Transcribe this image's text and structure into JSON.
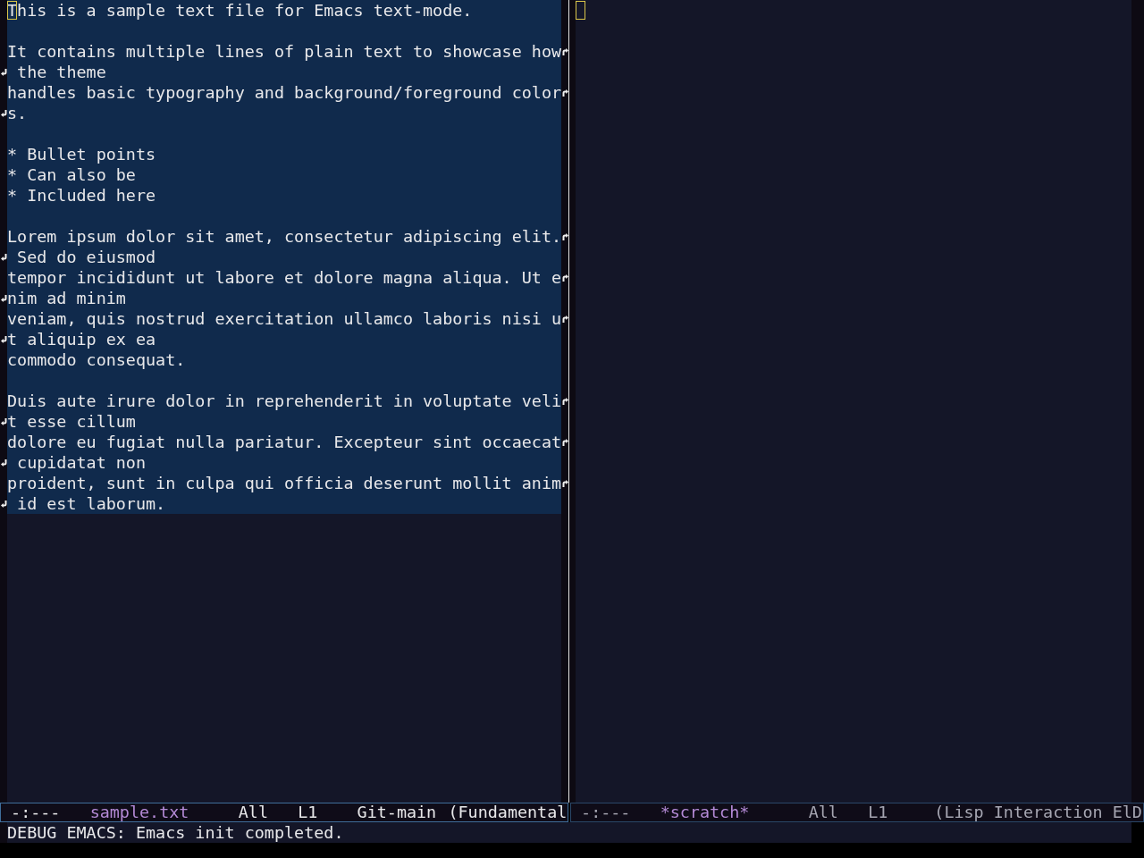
{
  "windows": [
    {
      "cursor": true,
      "region_active": true,
      "paragraphs": [
        {
          "lines": [
            {
              "text": "This is a sample text file for Emacs text-mode.",
              "wraps": false
            }
          ]
        },
        {
          "lines": [
            {
              "text": "It contains multiple lines of plain text to showcase how",
              "wraps": true
            },
            {
              "text": " the theme",
              "wraps": false
            },
            {
              "text": "handles basic typography and background/foreground color",
              "wraps": true
            },
            {
              "text": "s.",
              "wraps": false
            }
          ]
        },
        {
          "lines": [
            {
              "text": "* Bullet points",
              "wraps": false
            },
            {
              "text": "* Can also be",
              "wraps": false
            },
            {
              "text": "* Included here",
              "wraps": false
            }
          ]
        },
        {
          "lines": [
            {
              "text": "Lorem ipsum dolor sit amet, consectetur adipiscing elit.",
              "wraps": true
            },
            {
              "text": " Sed do eiusmod",
              "wraps": false
            },
            {
              "text": "tempor incididunt ut labore et dolore magna aliqua. Ut e",
              "wraps": true
            },
            {
              "text": "nim ad minim",
              "wraps": false
            },
            {
              "text": "veniam, quis nostrud exercitation ullamco laboris nisi u",
              "wraps": true
            },
            {
              "text": "t aliquip ex ea",
              "wraps": false
            },
            {
              "text": "commodo consequat.",
              "wraps": false
            }
          ]
        },
        {
          "lines": [
            {
              "text": "Duis aute irure dolor in reprehenderit in voluptate veli",
              "wraps": true
            },
            {
              "text": "t esse cillum",
              "wraps": false
            },
            {
              "text": "dolore eu fugiat nulla pariatur. Excepteur sint occaecat",
              "wraps": true
            },
            {
              "text": " cupidatat non",
              "wraps": false
            },
            {
              "text": "proident, sunt in culpa qui officia deserunt mollit anim",
              "wraps": true
            },
            {
              "text": " id est laborum.",
              "wraps": false
            }
          ]
        }
      ],
      "mode_line": {
        "active": true,
        "segments": [
          {
            "kind": "status",
            "text": "-:---"
          },
          {
            "kind": "buffer",
            "text": "sample.txt"
          },
          {
            "kind": "position",
            "text": "All"
          },
          {
            "kind": "line",
            "text": "L1"
          },
          {
            "kind": "vc",
            "text": "Git-main"
          },
          {
            "kind": "mode",
            "text": "(Fundamental"
          }
        ]
      }
    },
    {
      "cursor": true,
      "mode_line": {
        "active": false,
        "segments": [
          {
            "kind": "status",
            "text": "-:---"
          },
          {
            "kind": "buffer",
            "text": "*scratch*"
          },
          {
            "kind": "position",
            "text": "All"
          },
          {
            "kind": "line",
            "text": "L1"
          },
          {
            "kind": "mode",
            "text": "(Lisp Interaction ElD"
          }
        ]
      }
    }
  ],
  "echo_area": {
    "message": "DEBUG EMACS: Emacs init completed."
  }
}
